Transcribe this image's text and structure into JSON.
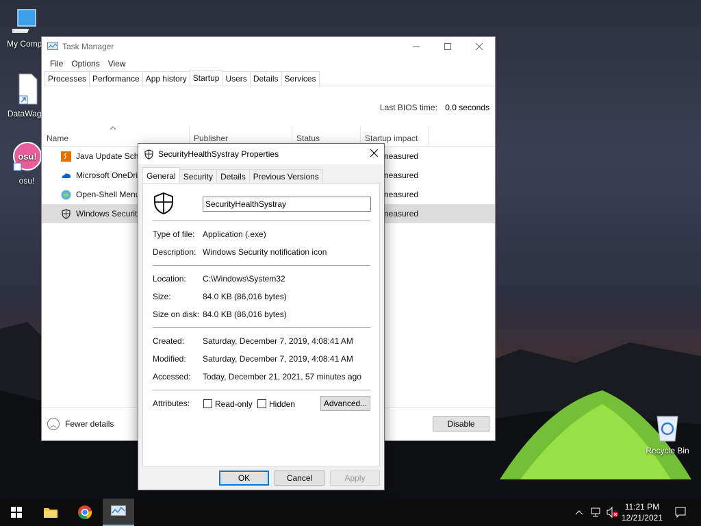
{
  "desktop": {
    "icons": [
      {
        "label": "My Compu",
        "icon": "computer-icon"
      },
      {
        "label": "DataWago",
        "icon": "file-shortcut-icon"
      },
      {
        "label": "osu!",
        "icon": "osu-icon",
        "logo_text": "osu!"
      },
      {
        "label": "Recycle Bin",
        "icon": "recycle-bin-icon"
      }
    ]
  },
  "task_manager": {
    "title": "Task Manager",
    "menu": [
      "File",
      "Options",
      "View"
    ],
    "tabs": [
      "Processes",
      "Performance",
      "App history",
      "Startup",
      "Users",
      "Details",
      "Services"
    ],
    "active_tab": "Startup",
    "bios_label": "Last BIOS time:",
    "bios_value": "0.0 seconds",
    "columns": [
      "Name",
      "Publisher",
      "Status",
      "Startup impact"
    ],
    "rows": [
      {
        "name": "Java Update Sche",
        "impact": "neasured",
        "icon": "java-icon"
      },
      {
        "name": "Microsoft OneDri",
        "impact": "neasured",
        "icon": "onedrive-icon"
      },
      {
        "name": "Open-Shell Menu",
        "impact": "neasured",
        "icon": "open-shell-icon"
      },
      {
        "name": "Windows Security",
        "impact": "neasured",
        "icon": "shield-icon",
        "selected": true
      }
    ],
    "fewer_details": "Fewer details",
    "disable_button": "Disable"
  },
  "properties": {
    "title": "SecurityHealthSystray Properties",
    "tabs": [
      "General",
      "Security",
      "Details",
      "Previous Versions"
    ],
    "active_tab": "General",
    "file_name": "SecurityHealthSystray",
    "type_label": "Type of file:",
    "type_value": "Application (.exe)",
    "desc_label": "Description:",
    "desc_value": "Windows Security notification icon",
    "location_label": "Location:",
    "location_value": "C:\\Windows\\System32",
    "size_label": "Size:",
    "size_value": "84.0 KB (86,016 bytes)",
    "size_disk_label": "Size on disk:",
    "size_disk_value": "84.0 KB (86,016 bytes)",
    "created_label": "Created:",
    "created_value": "Saturday, December 7, 2019, 4:08:41 AM",
    "modified_label": "Modified:",
    "modified_value": "Saturday, December 7, 2019, 4:08:41 AM",
    "accessed_label": "Accessed:",
    "accessed_value": "Today, December 21, 2021, 57 minutes ago",
    "attributes_label": "Attributes:",
    "readonly_label": "Read-only",
    "hidden_label": "Hidden",
    "advanced_button": "Advanced...",
    "ok_button": "OK",
    "cancel_button": "Cancel",
    "apply_button": "Apply"
  },
  "taskbar": {
    "time": "11:21 PM",
    "date": "12/21/2021"
  },
  "colors": {
    "selection": "#dcdcdc",
    "taskbar": "#0c0c0c",
    "ok_border": "#0078d7"
  }
}
